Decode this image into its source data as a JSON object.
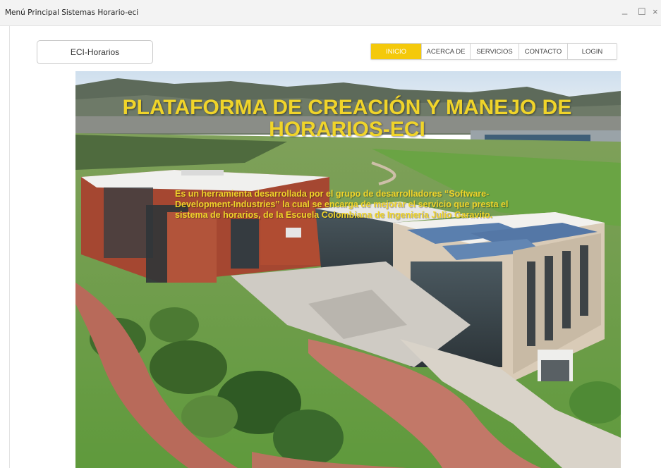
{
  "window": {
    "title": "Menú Principal Sistemas Horario-eci",
    "minimize_glyph": "_",
    "maximize_glyph": "☐",
    "close_glyph": "×"
  },
  "brand": {
    "label": "ECI-Horarios"
  },
  "nav": {
    "items": [
      {
        "label": "INICIO",
        "active": true
      },
      {
        "label": "ACERCA DE",
        "active": false
      },
      {
        "label": "SERVICIOS",
        "active": false
      },
      {
        "label": "CONTACTO",
        "active": false
      },
      {
        "label": "LOGIN",
        "active": false
      }
    ]
  },
  "hero": {
    "title": "PLATAFORMA DE CREACIÓN Y MANEJO DE HORARIOS-ECI",
    "description": "Es un herramienta desarrollada por el grupo de desarrolladores “Software-Development-Industries” la cual se encarga de mejorar el servicio que presta el sistema de horarios, de la Escuela Colombiana de Ingeniería Julio Garavito.",
    "image_subject": "aerial-campus-photo"
  },
  "colors": {
    "accent": "#f4c90b",
    "hero_text": "#f0d42a"
  }
}
